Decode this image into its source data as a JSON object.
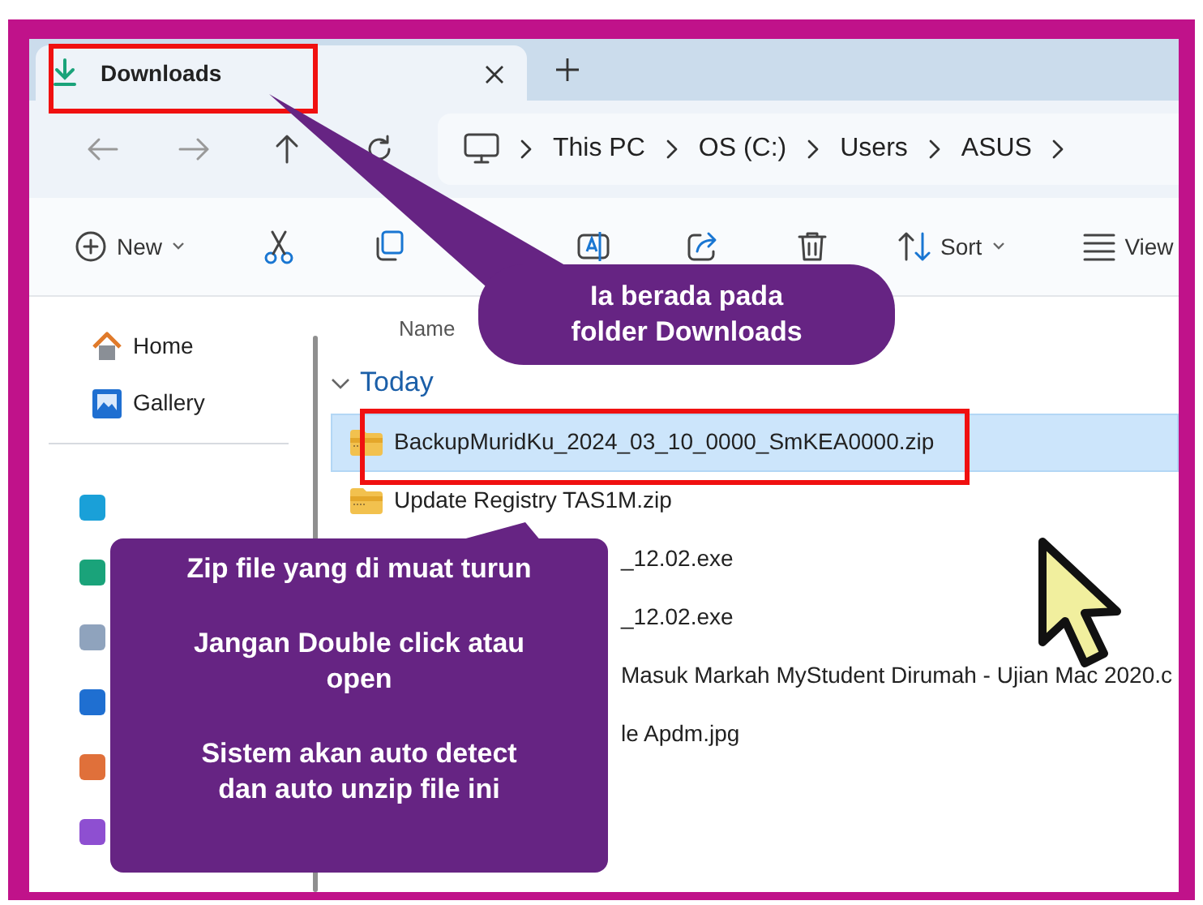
{
  "tabs": [
    {
      "label": "Downloads",
      "selected": true
    }
  ],
  "breadcrumb": [
    "This PC",
    "OS (C:)",
    "Users",
    "ASUS"
  ],
  "toolbar": [
    {
      "kind": "new",
      "label": "New"
    },
    {
      "kind": "cut"
    },
    {
      "kind": "copy"
    },
    {
      "kind": "rename"
    },
    {
      "kind": "share"
    },
    {
      "kind": "delete"
    },
    {
      "kind": "sort",
      "label": "Sort"
    },
    {
      "kind": "view",
      "label": "View"
    }
  ],
  "sidebar": {
    "items": [
      {
        "label": "Home",
        "kind": "home"
      },
      {
        "label": "Gallery",
        "kind": "gallery"
      }
    ]
  },
  "file_list": {
    "column_header": "Name",
    "groups": [
      {
        "label": "Today",
        "expanded": true,
        "files": [
          {
            "name": "BackupMuridKu_2024_03_10_0000_SmKEA0000.zip",
            "kind": "zip",
            "selected": true
          },
          {
            "name": "Update Registry TAS1M.zip",
            "kind": "zip",
            "selected": false
          },
          {
            "name": "_12.02.exe",
            "kind": "covered",
            "selected": false
          },
          {
            "name": "_12.02.exe",
            "kind": "covered",
            "selected": false
          },
          {
            "name": "Masuk Markah MyStudent Dirumah - Ujian Mac 2020.c",
            "kind": "covered",
            "selected": false
          },
          {
            "name": "le Apdm.jpg",
            "kind": "covered",
            "selected": false
          }
        ]
      }
    ]
  },
  "annotations": [
    {
      "kind": "top",
      "paragraphs": [
        "Ia berada pada\nfolder Downloads"
      ]
    },
    {
      "kind": "bottom",
      "paragraphs": [
        "Zip file yang di muat turun",
        "Jangan Double click atau\nopen",
        "Sistem akan auto detect\ndan auto unzip file ini"
      ]
    }
  ]
}
